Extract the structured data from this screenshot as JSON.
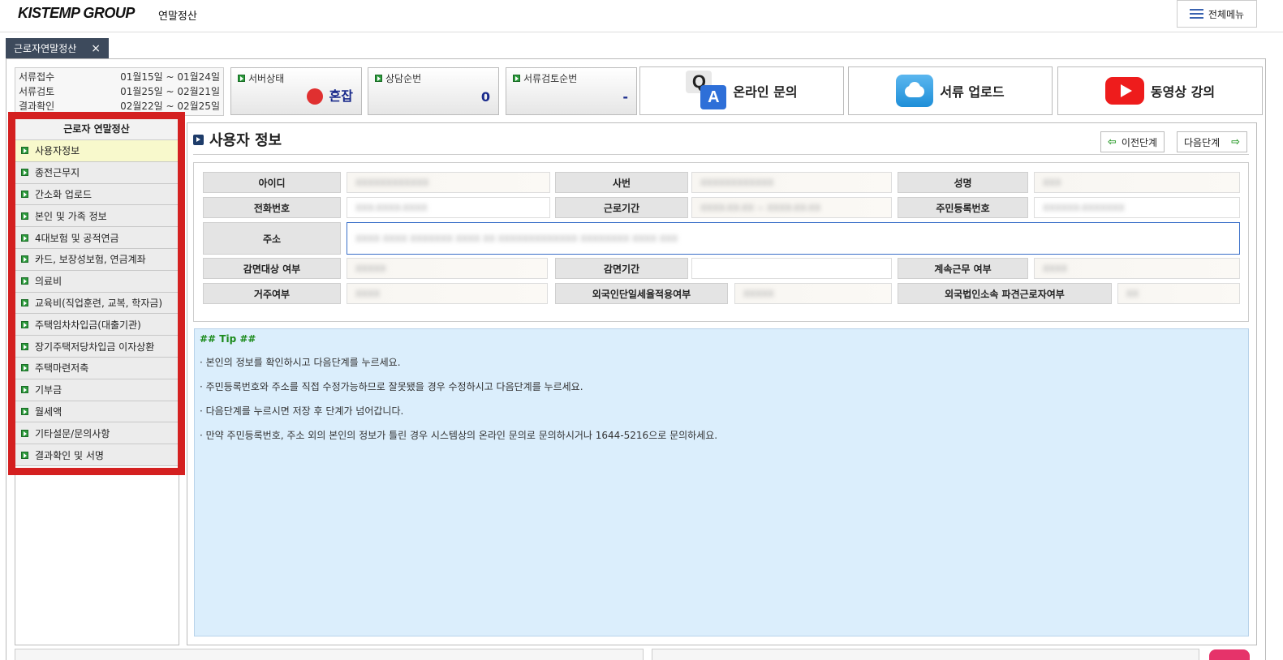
{
  "header": {
    "logo": "KISTEMP GROUP",
    "app_title": "연말정산",
    "all_menu_label": "전체메뉴"
  },
  "tabs": [
    {
      "label": "근로자연말정산",
      "close": "×"
    }
  ],
  "schedule": [
    {
      "label": "서류접수",
      "period": "01월15일 ~ 01월24일"
    },
    {
      "label": "서류검토",
      "period": "01월25일 ~ 02월21일"
    },
    {
      "label": "결과확인",
      "period": "02월22일 ~ 02월25일"
    }
  ],
  "status": {
    "server": {
      "label": "서버상태",
      "value": "혼잡",
      "color": "#e03030"
    },
    "consult": {
      "label": "상담순번",
      "value": "0"
    },
    "review": {
      "label": "서류검토순번",
      "value": "-"
    }
  },
  "actions": {
    "online_inquiry": "온라인 문의",
    "upload": "서류 업로드",
    "video": "동영상 강의"
  },
  "sidebar": {
    "title": "근로자 연말정산",
    "items": [
      {
        "label": "사용자정보",
        "active": true
      },
      {
        "label": "종전근무지"
      },
      {
        "label": "간소화 업로드"
      },
      {
        "label": "본인 및 가족 정보"
      },
      {
        "label": "4대보험 및 공적연금"
      },
      {
        "label": "카드, 보장성보험, 연금계좌"
      },
      {
        "label": "의료비"
      },
      {
        "label": "교육비(직업훈련, 교복, 학자금)"
      },
      {
        "label": "주택임차차입금(대출기관)"
      },
      {
        "label": "장기주택저당차입금 이자상환"
      },
      {
        "label": "주택마련저축"
      },
      {
        "label": "기부금"
      },
      {
        "label": "월세액"
      },
      {
        "label": "기타설문/문의사항"
      },
      {
        "label": "결과확인 및 서명"
      }
    ]
  },
  "section": {
    "title": "사용자 정보",
    "prev_label": "이전단계",
    "next_label": "다음단계"
  },
  "form": {
    "id_label": "아이디",
    "id_value": "XXXXXXXXXXXX",
    "empno_label": "사번",
    "empno_value": "XXXXXXXXXXXX",
    "name_label": "성명",
    "name_value": "XXX",
    "phone_label": "전화번호",
    "phone_value": "XXX-XXXX-XXXX",
    "period_label": "근로기간",
    "period_value": "XXXX-XX-XX ~ XXXX-XX-XX",
    "rrn_label": "주민등록번호",
    "rrn_value": "XXXXXX-XXXXXXX",
    "addr_label": "주소",
    "addr_value": "XXXX XXXX XXXXXXX XXXX XX XXXXXXXXXXXXX XXXXXXXX XXXX XXX",
    "exempt_label": "감면대상 여부",
    "exempt_value": "XXXXX",
    "exempt_period_label": "감면기간",
    "exempt_period_value": "",
    "continuous_label": "계속근무 여부",
    "continuous_value": "XXXX",
    "resident_label": "거주여부",
    "resident_value": "XXXX",
    "flat_tax_label": "외국인단일세율적용여부",
    "flat_tax_value": "XXXXX",
    "dispatch_label": "외국법인소속 파견근로자여부",
    "dispatch_value": "XX"
  },
  "tip": {
    "title": "## Tip ##",
    "lines": [
      "· 본인의 정보를 확인하시고 다음단계를 누르세요.",
      "· 주민등록번호와 주소를 직접 수정가능하므로 잘못됐을 경우 수정하시고 다음단계를 누르세요.",
      "· 다음단계를 누르시면 저장 후 단계가 넘어갑니다.",
      "· 만약 주민등록번호, 주소 외의 본인의 정보가 틀린 경우 시스템상의 온라인 문의로 문의하시거나 1644-5216으로 문의하세요."
    ]
  }
}
